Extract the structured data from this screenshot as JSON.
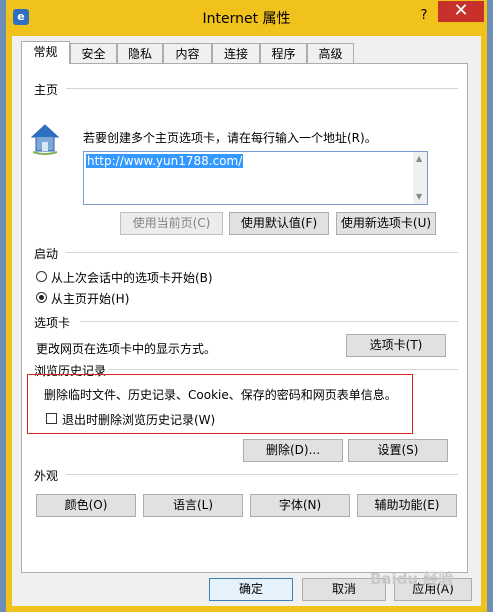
{
  "window": {
    "title": "Internet 属性",
    "help_glyph": "?",
    "close_glyph": "✕"
  },
  "tabs": [
    {
      "label": "常规",
      "active": true
    },
    {
      "label": "安全"
    },
    {
      "label": "隐私"
    },
    {
      "label": "内容"
    },
    {
      "label": "连接"
    },
    {
      "label": "程序"
    },
    {
      "label": "高级"
    }
  ],
  "homepage": {
    "section_label": "主页",
    "instruction": "若要创建多个主页选项卡，请在每行输入一个地址(R)。",
    "url": "http://www.yun1788.com/",
    "use_current_label": "使用当前页(C)",
    "use_default_label": "使用默认值(F)",
    "use_new_tab_label": "使用新选项卡(U)"
  },
  "startup": {
    "section_label": "启动",
    "option_last_session": "从上次会话中的选项卡开始(B)",
    "option_homepage": "从主页开始(H)",
    "selected": "homepage"
  },
  "tabs_section": {
    "section_label": "选项卡",
    "description": "更改网页在选项卡中的显示方式。",
    "button_label": "选项卡(T)"
  },
  "history": {
    "section_label": "浏览历史记录",
    "description": "删除临时文件、历史记录、Cookie、保存的密码和网页表单信息。",
    "delete_on_exit_label": "退出时删除浏览历史记录(W)",
    "delete_on_exit_checked": false,
    "delete_label": "删除(D)...",
    "settings_label": "设置(S)"
  },
  "appearance": {
    "section_label": "外观",
    "colors_label": "颜色(O)",
    "languages_label": "语言(L)",
    "fonts_label": "字体(N)",
    "accessibility_label": "辅助功能(E)"
  },
  "footer": {
    "ok_label": "确定",
    "cancel_label": "取消",
    "apply_label": "应用(A)"
  },
  "watermark": "Baidu 经验",
  "colors": {
    "title_bar": "#f1c21b",
    "close_button": "#c7302b",
    "highlight": "#d22222"
  }
}
